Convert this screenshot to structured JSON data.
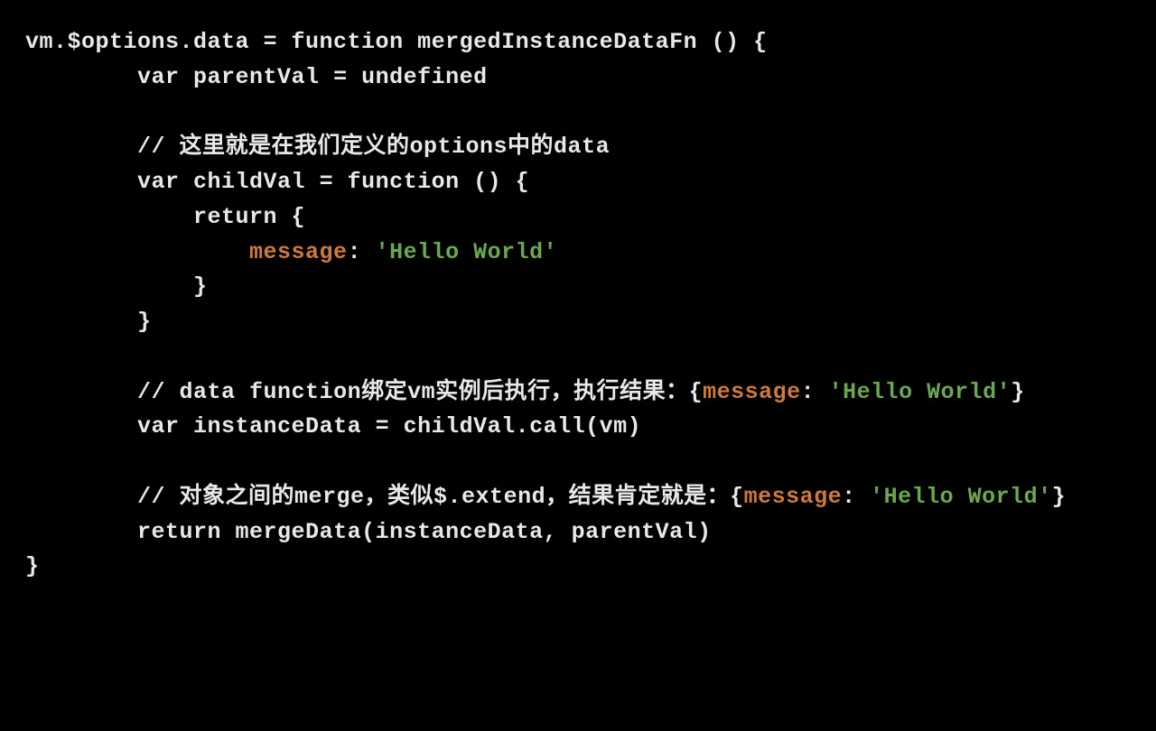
{
  "code": {
    "l1": "vm.$options.data = function mergedInstanceDataFn () {",
    "l2": "        var parentVal = undefined",
    "l3": "",
    "l4_pre": "        // 这里就是在我们定义的options中的data",
    "l5": "        var childVal = function () {",
    "l6": "            return {",
    "l7_prop": "message",
    "l7_colon": ": ",
    "l7_str": "'Hello World'",
    "l7_indent": "                ",
    "l8": "            }",
    "l9": "        }",
    "l10": "",
    "l11_pre": "        // data function绑定vm实例后执行，执行结果：{",
    "l11_prop": "message",
    "l11_colon": ": ",
    "l12_str": "'Hello World'",
    "l12_close": "}",
    "l13": "        var instanceData = childVal.call(vm)",
    "l14": "",
    "l15_pre": "        // 对象之间的merge，类似$.extend，结果肯定就是：{",
    "l15_prop": "message",
    "l15_colon": ": ",
    "l15_str": "'Hello World'",
    "l15_close": "}",
    "l16": "        return mergeData(instanceData, parentVal)",
    "l17": "}"
  }
}
